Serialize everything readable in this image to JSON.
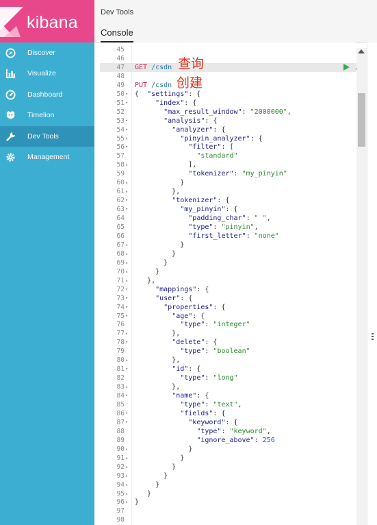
{
  "app": {
    "name": "kibana",
    "brand_color": "#e8488b",
    "sidebar_color": "#3caed2"
  },
  "sidebar": {
    "items": [
      {
        "label": "Discover",
        "icon": "compass-icon"
      },
      {
        "label": "Visualize",
        "icon": "bar-chart-icon"
      },
      {
        "label": "Dashboard",
        "icon": "dashboard-icon"
      },
      {
        "label": "Timelion",
        "icon": "timelion-icon"
      },
      {
        "label": "Dev Tools",
        "icon": "wrench-icon",
        "active": true
      },
      {
        "label": "Management",
        "icon": "gear-icon"
      }
    ]
  },
  "header": {
    "breadcrumb": "Dev Tools",
    "tab": "Console"
  },
  "annotations": {
    "query": "查询",
    "create": "创建"
  },
  "editor": {
    "lines": [
      {
        "n": "45",
        "f": "",
        "t": ""
      },
      {
        "n": "46",
        "f": "",
        "t": ""
      },
      {
        "n": "47",
        "f": "",
        "t": "",
        "req": {
          "method": "GET",
          "url": "/csdn"
        },
        "hl": true
      },
      {
        "n": "48",
        "f": "",
        "t": ""
      },
      {
        "n": "49",
        "f": "",
        "t": "",
        "req": {
          "method": "PUT",
          "url": "/csdn"
        }
      },
      {
        "n": "50",
        "f": "▾",
        "t": "{  \"settings\": {"
      },
      {
        "n": "51",
        "f": "▾",
        "t": "     \"index\": {"
      },
      {
        "n": "52",
        "f": "",
        "t": "       \"max_result_window\": \"2000000\","
      },
      {
        "n": "53",
        "f": "▾",
        "t": "       \"analysis\": {"
      },
      {
        "n": "54",
        "f": "▾",
        "t": "         \"analyzer\": {"
      },
      {
        "n": "55",
        "f": "▾",
        "t": "           \"pinyin_analyzer\": {"
      },
      {
        "n": "56",
        "f": "▾",
        "t": "             \"filter\": ["
      },
      {
        "n": "57",
        "f": "",
        "t": "               \"standard\""
      },
      {
        "n": "58",
        "f": "▴",
        "t": "             ],"
      },
      {
        "n": "59",
        "f": "",
        "t": "             \"tokenizer\": \"my_pinyin\""
      },
      {
        "n": "60",
        "f": "▴",
        "t": "           }"
      },
      {
        "n": "61",
        "f": "▴",
        "t": "         },"
      },
      {
        "n": "62",
        "f": "▾",
        "t": "         \"tokenizer\": {"
      },
      {
        "n": "63",
        "f": "▾",
        "t": "           \"my_pinyin\": {"
      },
      {
        "n": "64",
        "f": "",
        "t": "             \"padding_char\": \" \","
      },
      {
        "n": "65",
        "f": "",
        "t": "             \"type\": \"pinyin\","
      },
      {
        "n": "66",
        "f": "",
        "t": "             \"first_letter\": \"none\""
      },
      {
        "n": "67",
        "f": "▴",
        "t": "           }"
      },
      {
        "n": "68",
        "f": "▴",
        "t": "         }"
      },
      {
        "n": "69",
        "f": "▴",
        "t": "       }"
      },
      {
        "n": "70",
        "f": "▴",
        "t": "     }"
      },
      {
        "n": "71",
        "f": "▴",
        "t": "   },"
      },
      {
        "n": "72",
        "f": "▾",
        "t": "     \"mappings\": {"
      },
      {
        "n": "73",
        "f": "▾",
        "t": "     \"user\": {"
      },
      {
        "n": "74",
        "f": "▾",
        "t": "       \"properties\": {"
      },
      {
        "n": "75",
        "f": "▾",
        "t": "         \"age\": {"
      },
      {
        "n": "76",
        "f": "",
        "t": "           \"type\": \"integer\""
      },
      {
        "n": "77",
        "f": "▴",
        "t": "         },"
      },
      {
        "n": "78",
        "f": "▾",
        "t": "         \"delete\": {"
      },
      {
        "n": "79",
        "f": "",
        "t": "           \"type\": \"boolean\""
      },
      {
        "n": "80",
        "f": "▴",
        "t": "         },"
      },
      {
        "n": "81",
        "f": "▾",
        "t": "         \"id\": {"
      },
      {
        "n": "82",
        "f": "",
        "t": "           \"type\": \"long\""
      },
      {
        "n": "83",
        "f": "▴",
        "t": "         },"
      },
      {
        "n": "84",
        "f": "▾",
        "t": "         \"name\": {"
      },
      {
        "n": "85",
        "f": "",
        "t": "           \"type\": \"text\","
      },
      {
        "n": "86",
        "f": "▾",
        "t": "           \"fields\": {"
      },
      {
        "n": "87",
        "f": "▾",
        "t": "             \"keyword\": {"
      },
      {
        "n": "88",
        "f": "",
        "t": "               \"type\": \"keyword\","
      },
      {
        "n": "89",
        "f": "",
        "t": "               \"ignore_above\": 256"
      },
      {
        "n": "90",
        "f": "▴",
        "t": "             }"
      },
      {
        "n": "91",
        "f": "▴",
        "t": "           }"
      },
      {
        "n": "92",
        "f": "▴",
        "t": "         }"
      },
      {
        "n": "93",
        "f": "▴",
        "t": "       }"
      },
      {
        "n": "94",
        "f": "▴",
        "t": "     }"
      },
      {
        "n": "95",
        "f": "▴",
        "t": "   }"
      },
      {
        "n": "96",
        "f": "▴",
        "t": "}"
      },
      {
        "n": "97",
        "f": "",
        "t": ""
      },
      {
        "n": "98",
        "f": "",
        "t": ""
      }
    ]
  }
}
